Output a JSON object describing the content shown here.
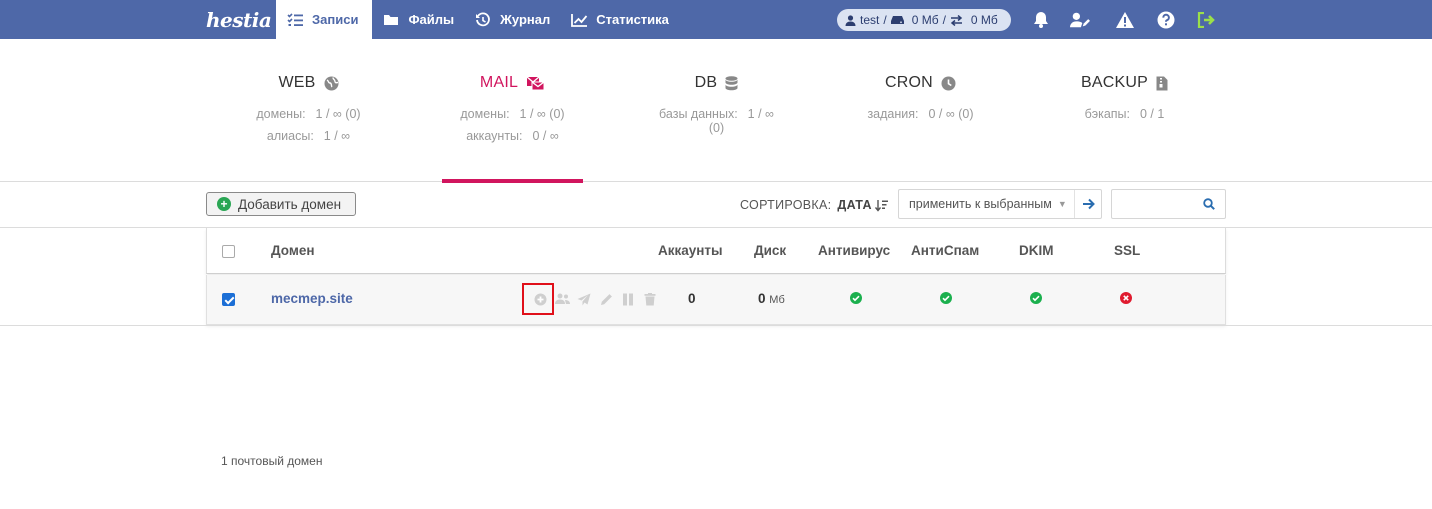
{
  "app": {
    "logo_text": "hestia"
  },
  "nav": [
    {
      "label": "Записи",
      "icon": "list-check-icon",
      "active": true
    },
    {
      "label": "Файлы",
      "icon": "folder-icon",
      "active": false
    },
    {
      "label": "Журнал",
      "icon": "history-icon",
      "active": false
    },
    {
      "label": "Статистика",
      "icon": "chart-line-icon",
      "active": false
    }
  ],
  "user": {
    "name": "test",
    "sep1": "/",
    "disk": "0 Мб",
    "sep2": "/",
    "bandwidth": "0 Мб"
  },
  "top_icons": [
    "bell-icon",
    "user-edit-icon",
    "warning-icon",
    "help-icon",
    "logout-icon"
  ],
  "stats": [
    {
      "title": "WEB",
      "icon": "globe-icon",
      "rows": [
        {
          "label": "домены:",
          "value": "1 / ∞ (0)"
        },
        {
          "label": "алиасы:",
          "value": "1 / ∞"
        }
      ]
    },
    {
      "title": "MAIL",
      "icon": "mail-icon",
      "active": true,
      "rows": [
        {
          "label": "домены:",
          "value": "1 / ∞ (0)"
        },
        {
          "label": "аккаунты:",
          "value": "0 / ∞"
        }
      ]
    },
    {
      "title": "DB",
      "icon": "database-icon",
      "rows": [
        {
          "label": "базы данных:",
          "value": "1 / ∞"
        },
        {
          "label": "",
          "value": "(0)"
        }
      ]
    },
    {
      "title": "CRON",
      "icon": "clock-icon",
      "rows": [
        {
          "label": "задания:",
          "value": "0 / ∞ (0)"
        }
      ]
    },
    {
      "title": "BACKUP",
      "icon": "file-archive-icon",
      "rows": [
        {
          "label": "бэкапы:",
          "value": "0 / 1"
        }
      ]
    }
  ],
  "toolbar": {
    "add_label": "Добавить домен",
    "sort_label": "СОРТИРОВКА:",
    "sort_value": "ДАТА",
    "apply_label": "применить к выбранным",
    "search_placeholder": ""
  },
  "table": {
    "headers": {
      "domain": "Домен",
      "accounts": "Аккаунты",
      "disk": "Диск",
      "antivirus": "Антивирус",
      "antispam": "АнтиСпам",
      "dkim": "DKIM",
      "ssl": "SSL"
    },
    "rows": [
      {
        "domain": "mecmep.site",
        "checked": true,
        "accounts": "0",
        "disk_value": "0",
        "disk_unit": "Мб",
        "antivirus": "ok",
        "antispam": "ok",
        "dkim": "ok",
        "ssl": "error"
      }
    ]
  },
  "footer": {
    "count_text": "1 почтовый домен"
  },
  "colors": {
    "topbar": "#4e68a8",
    "accent": "#d1155e",
    "ok": "#1bb04e",
    "error": "#e01b2f",
    "highlight": "#e0101a"
  }
}
